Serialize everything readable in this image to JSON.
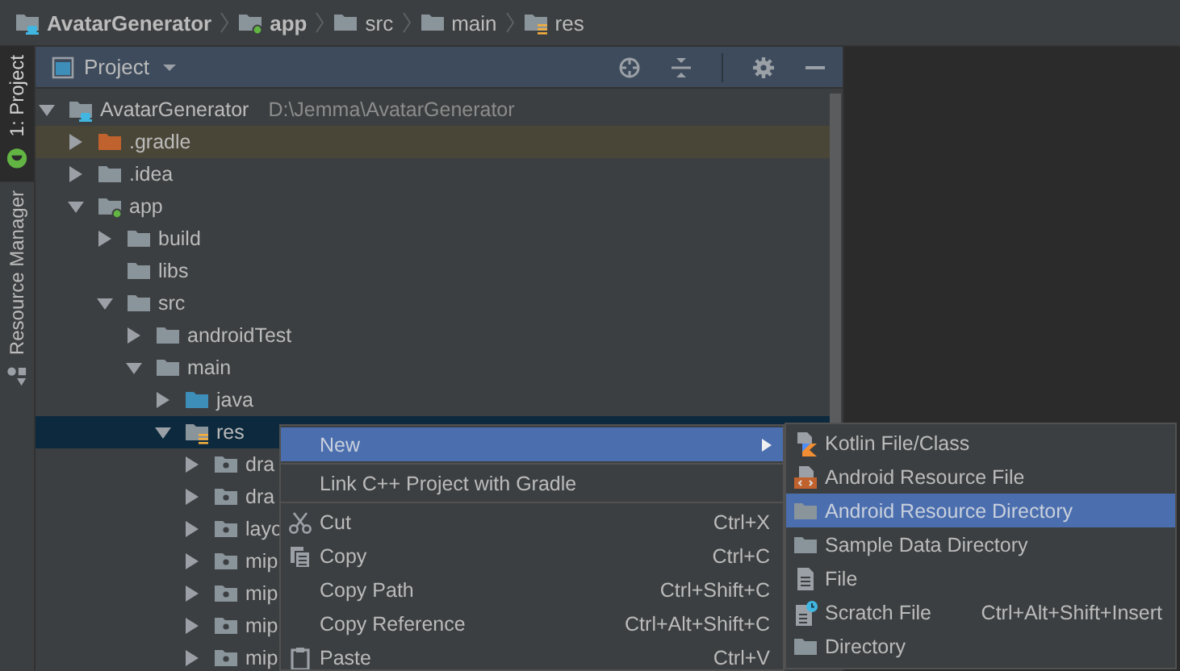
{
  "breadcrumbs": [
    {
      "label": "AvatarGenerator",
      "kind": "project"
    },
    {
      "label": "app",
      "kind": "module"
    },
    {
      "label": "src",
      "kind": "folder"
    },
    {
      "label": "main",
      "kind": "folder"
    },
    {
      "label": "res",
      "kind": "resource-folder"
    }
  ],
  "side_tabs": [
    {
      "label": "1: Project",
      "kind": "android",
      "selected": true
    },
    {
      "label": "Resource Manager",
      "kind": "resources",
      "selected": false
    }
  ],
  "project_panel": {
    "title": "Project",
    "tree": [
      {
        "label": "AvatarGenerator",
        "path": "D:\\Jemma\\AvatarGenerator",
        "kind": "project",
        "expanded": true,
        "selected": false,
        "children": [
          {
            "label": ".gradle",
            "kind": "excluded-folder",
            "expanded": false,
            "selected": false
          },
          {
            "label": ".idea",
            "kind": "folder",
            "expanded": false,
            "selected": false
          },
          {
            "label": "app",
            "kind": "module",
            "expanded": true,
            "selected": false,
            "children": [
              {
                "label": "build",
                "kind": "folder",
                "expanded": false,
                "selected": false
              },
              {
                "label": "libs",
                "kind": "folder",
                "selected": false
              },
              {
                "label": "src",
                "kind": "folder",
                "expanded": true,
                "selected": false,
                "children": [
                  {
                    "label": "androidTest",
                    "kind": "folder",
                    "expanded": false,
                    "selected": false
                  },
                  {
                    "label": "main",
                    "kind": "folder",
                    "expanded": true,
                    "selected": false,
                    "children": [
                      {
                        "label": "java",
                        "kind": "source-folder",
                        "expanded": false,
                        "selected": false
                      },
                      {
                        "label": "res",
                        "kind": "resource-folder",
                        "expanded": true,
                        "selected": true,
                        "children": [
                          {
                            "label": "dra",
                            "kind": "res-folder",
                            "expanded": false,
                            "selected": false
                          },
                          {
                            "label": "dra",
                            "kind": "res-folder",
                            "expanded": false,
                            "selected": false
                          },
                          {
                            "label": "layo",
                            "kind": "res-folder",
                            "expanded": false,
                            "selected": false
                          },
                          {
                            "label": "mip",
                            "kind": "res-folder",
                            "expanded": false,
                            "selected": false
                          },
                          {
                            "label": "mip",
                            "kind": "res-folder",
                            "expanded": false,
                            "selected": false
                          },
                          {
                            "label": "mip",
                            "kind": "res-folder",
                            "expanded": false,
                            "selected": false
                          },
                          {
                            "label": "mip",
                            "kind": "res-folder",
                            "expanded": false,
                            "selected": false
                          }
                        ]
                      }
                    ]
                  }
                ]
              }
            ]
          }
        ]
      }
    ]
  },
  "context_menu": {
    "items": [
      {
        "kind": "submenu",
        "label": "New",
        "selected": true
      },
      {
        "kind": "separator"
      },
      {
        "kind": "action",
        "label": "Link C++ Project with Gradle",
        "selected": false
      },
      {
        "kind": "separator"
      },
      {
        "kind": "cut",
        "label": "Cut",
        "shortcut": "Ctrl+X",
        "selected": false
      },
      {
        "kind": "copy",
        "label": "Copy",
        "shortcut": "Ctrl+C",
        "selected": false
      },
      {
        "kind": "action",
        "label": "Copy Path",
        "shortcut": "Ctrl+Shift+C",
        "selected": false
      },
      {
        "kind": "action",
        "label": "Copy Reference",
        "shortcut": "Ctrl+Alt+Shift+C",
        "selected": false
      },
      {
        "kind": "paste",
        "label": "Paste",
        "shortcut": "Ctrl+V",
        "selected": false
      }
    ]
  },
  "submenu": {
    "items": [
      {
        "kind": "kotlin",
        "label": "Kotlin File/Class",
        "selected": false
      },
      {
        "kind": "resource-file",
        "label": "Android Resource File",
        "selected": false
      },
      {
        "kind": "folder",
        "label": "Android Resource Directory",
        "selected": true
      },
      {
        "kind": "folder",
        "label": "Sample Data Directory",
        "selected": false
      },
      {
        "kind": "file",
        "label": "File",
        "selected": false
      },
      {
        "kind": "scratch",
        "label": "Scratch File",
        "shortcut": "Ctrl+Alt+Shift+Insert",
        "selected": false
      },
      {
        "kind": "folder",
        "label": "Directory",
        "selected": false
      }
    ]
  }
}
